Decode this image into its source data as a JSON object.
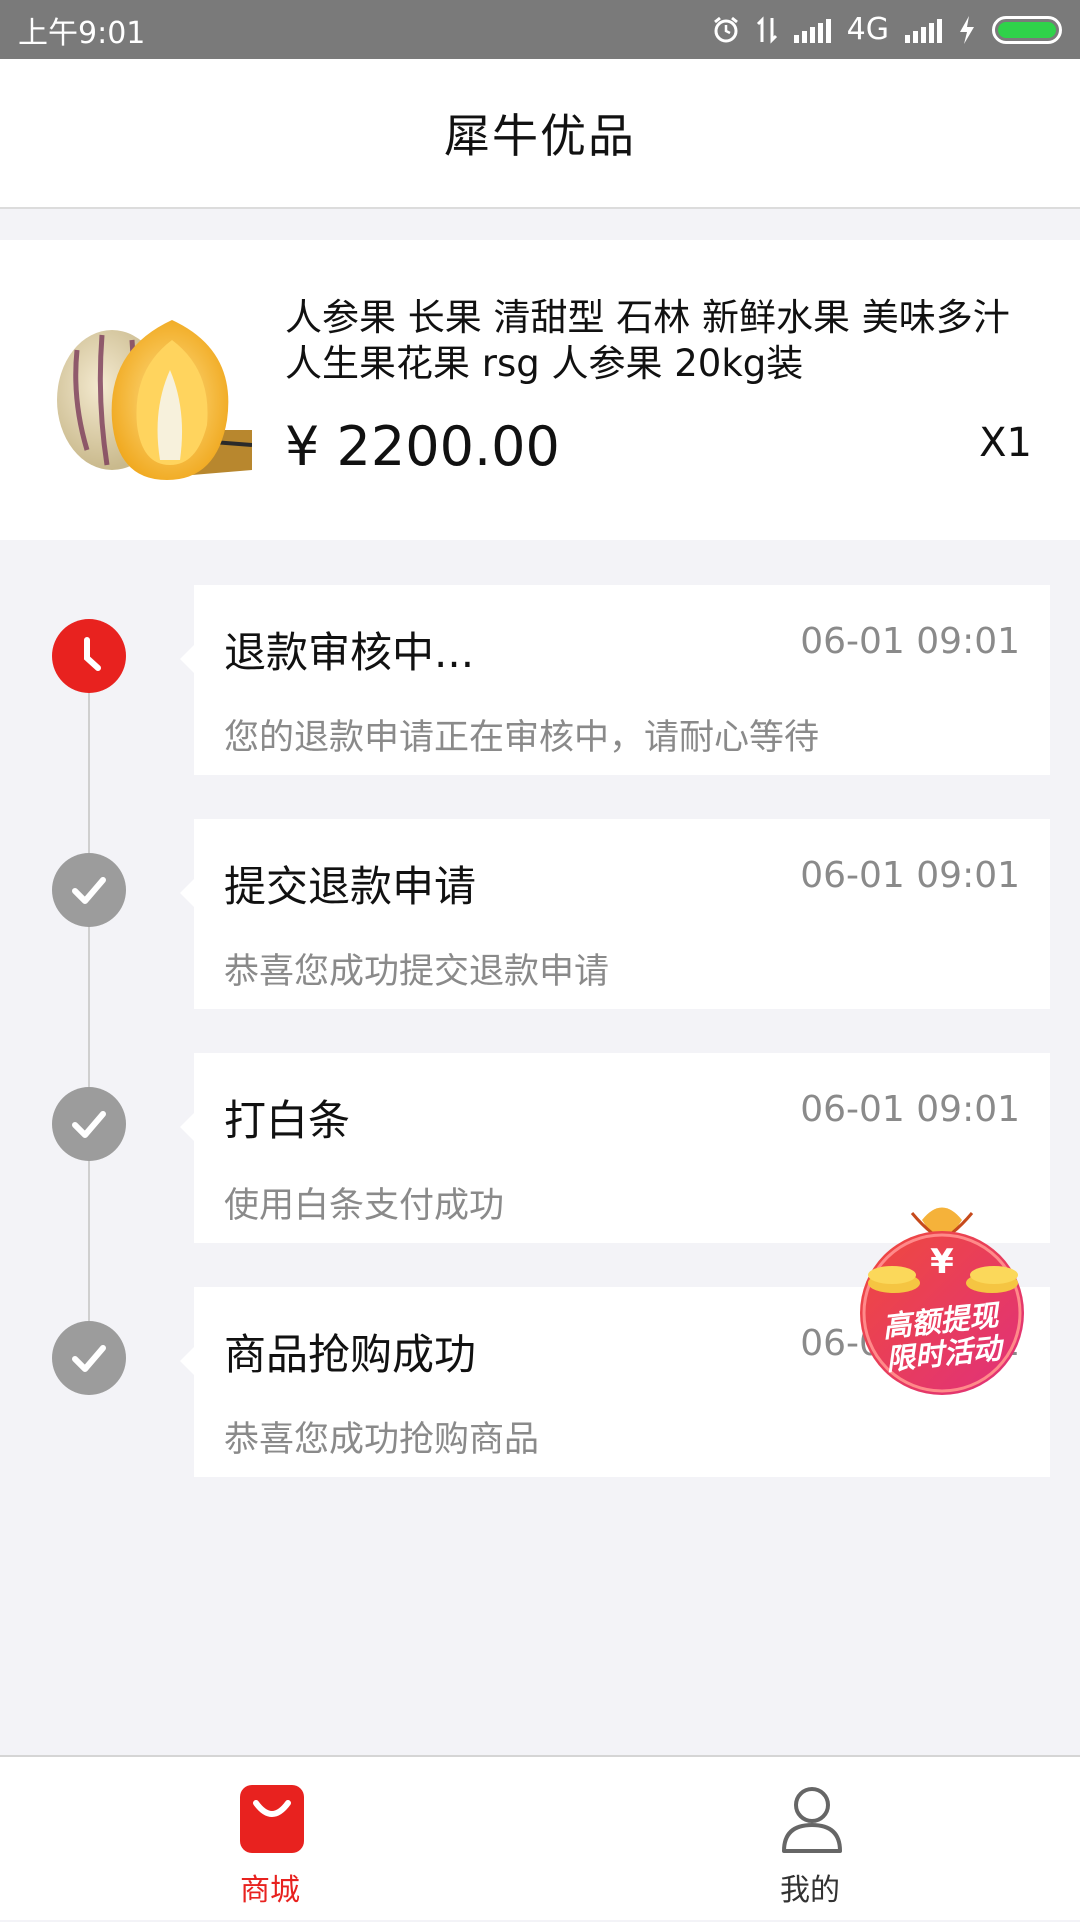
{
  "status_bar": {
    "time": "上午9:01",
    "network": "4G",
    "colors": {
      "background": "#7a7a7a",
      "battery": "#2fd24a"
    },
    "icons": [
      "alarm-icon",
      "data-transfer-icon",
      "signal-icon",
      "signal-icon",
      "charging-icon",
      "battery-icon"
    ]
  },
  "nav": {
    "title": "犀牛优品"
  },
  "product": {
    "name": "人参果 长果 清甜型 石林 新鲜水果 美味多汁 人生果花果 rsg 人参果 20kg装",
    "price": "¥ 2200.00",
    "quantity": "X1"
  },
  "timeline": {
    "items": [
      {
        "title": "退款审核中...",
        "time": "06-01 09:01",
        "desc": "您的退款申请正在审核中，请耐心等待",
        "state": "active",
        "icon": "clock-icon"
      },
      {
        "title": "提交退款申请",
        "time": "06-01 09:01",
        "desc": "恭喜您成功提交退款申请",
        "state": "done",
        "icon": "check-icon"
      },
      {
        "title": "打白条",
        "time": "06-01 09:01",
        "desc": "使用白条支付成功",
        "state": "done",
        "icon": "check-icon"
      },
      {
        "title": "商品抢购成功",
        "time": "06-01 09:01",
        "desc": "恭喜您成功抢购商品",
        "state": "done",
        "icon": "check-icon"
      }
    ],
    "colors": {
      "active": "#e8221f",
      "done": "#9c9c9c"
    }
  },
  "promo": {
    "symbol": "¥",
    "line1": "高额提现",
    "line2": "限时活动",
    "icon": "money-bag-icon"
  },
  "tabbar": {
    "items": [
      {
        "label": "商城",
        "icon": "shopping-bag-icon",
        "active": true
      },
      {
        "label": "我的",
        "icon": "user-icon",
        "active": false
      }
    ],
    "accent": "#e8221f"
  }
}
